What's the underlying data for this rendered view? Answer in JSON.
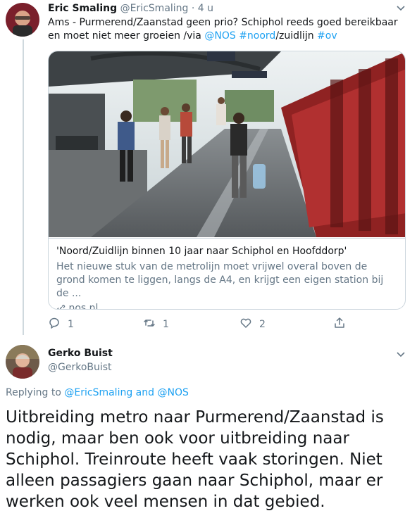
{
  "tweet1": {
    "author_name": "Eric Smaling",
    "author_handle": "@EricSmaling",
    "time": "· 4 u",
    "avatar": "avatar-eric",
    "text_part1": "Ams - Purmerend/Zaanstad geen prio? Schiphol reeds goed bereikbaar en moet niet meer groeien /via ",
    "mention_nos": "@NOS",
    "hashtag_noord": "#noord",
    "text_part2": "/zuidlijn ",
    "hashtag_ov": "#ov",
    "card": {
      "image": "metro-platform-photo",
      "title": "'Noord/Zuidlijn binnen 10 jaar naar Schiphol en Hoofddorp'",
      "description": "Het nieuwe stuk van de metrolijn moet vrijwel overal boven de grond komen te liggen, langs de A4, en krijgt een eigen station bij de ...",
      "domain": "nos.nl"
    },
    "actions": {
      "reply_count": "1",
      "retweet_count": "1",
      "like_count": "2"
    }
  },
  "tweet2": {
    "author_name": "Gerko Buist",
    "author_handle": "@GerkoBuist",
    "avatar": "avatar-gerko",
    "replying_prefix": "Replying to ",
    "replying_user1": "@EricSmaling",
    "replying_and": " and ",
    "replying_user2": "@NOS",
    "text": "Uitbreiding metro naar Purmerend/Zaanstad is nodig, maar ben ook voor uitbreiding naar Schiphol. Treinroute heeft vaak storingen. Niet alleen passagiers gaan naar Schiphol, maar er werken ook veel mensen in dat gebied."
  },
  "colors": {
    "link": "#1da1f2",
    "muted": "#657786",
    "text": "#14171a",
    "border": "#ccd6dd"
  }
}
